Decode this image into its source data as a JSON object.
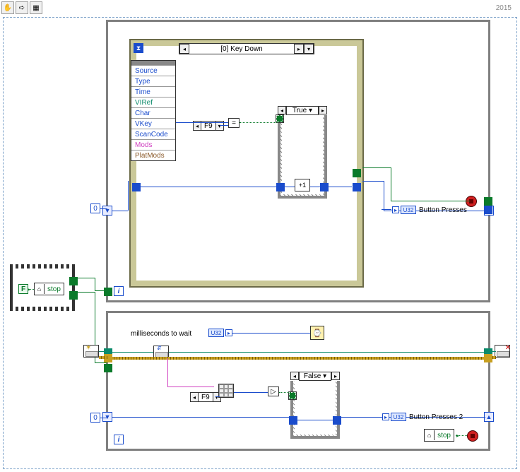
{
  "toolbar": {
    "hand": "✋",
    "arrow": "➪",
    "icon": "▦"
  },
  "year": "2015",
  "loop_top": {
    "i": "i",
    "zero_const": "0",
    "shift_down": "▼",
    "shift_up": "▲",
    "stop_label": "",
    "event": {
      "hourglass": "⧗",
      "selector_left": "◂",
      "selector_right": "▸",
      "selector_dd": "▾",
      "selector_label": "[0] Key Down",
      "rows": [
        {
          "text": "Source",
          "cls": "blue"
        },
        {
          "text": "Type",
          "cls": "blue"
        },
        {
          "text": "Time",
          "cls": "blue"
        },
        {
          "text": "VIRef",
          "cls": "teal"
        },
        {
          "text": "Char",
          "cls": "blue"
        },
        {
          "text": "VKey",
          "cls": "blue"
        },
        {
          "text": "ScanCode",
          "cls": "blue"
        },
        {
          "text": "Mods",
          "cls": "pink"
        },
        {
          "text": "PlatMods",
          "cls": "brown"
        }
      ],
      "f9": "F9",
      "eq": "=",
      "case_label": "True",
      "inc": "+1",
      "u32_label": "U32",
      "ind_label": "Button Presses"
    }
  },
  "seq": {
    "bool": "F",
    "local_stop": "stop",
    "house": "⌂"
  },
  "loop_bottom": {
    "i": "i",
    "zero_const": "0",
    "shift_down": "▼",
    "shift_up": "▲",
    "ms_label": "milliseconds to wait",
    "u32_ctrl": "U32",
    "wait": "⌚",
    "f9": "F9",
    "gt": "▷",
    "case_label": "False",
    "u32_label": "U32",
    "ind_label": "Button Presses 2",
    "local_stop": "stop",
    "house": "⌂"
  }
}
